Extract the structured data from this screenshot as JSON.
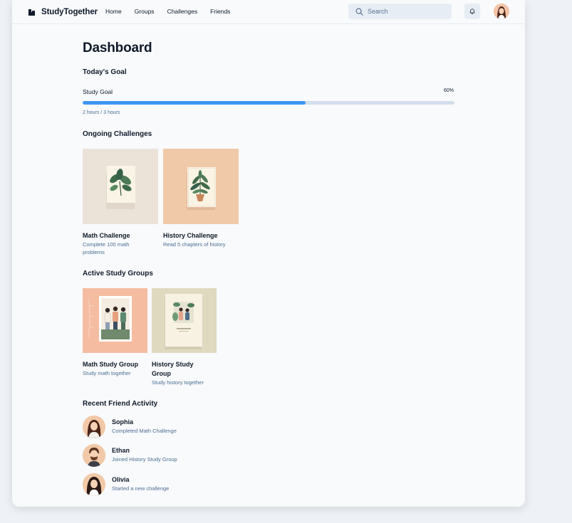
{
  "app": {
    "name": "StudyTogether",
    "nav": [
      "Home",
      "Groups",
      "Challenges",
      "Friends"
    ],
    "search_placeholder": "Search"
  },
  "page": {
    "title": "Dashboard"
  },
  "goal": {
    "section_title": "Today's Goal",
    "label": "Study Goal",
    "percent_label": "60%",
    "progress": 0.6,
    "detail": "2 hours / 3 hours"
  },
  "challenges": {
    "section_title": "Ongoing Challenges",
    "items": [
      {
        "title": "Math Challenge",
        "subtitle": "Complete 100 math problems",
        "tile_color": "#ebe3d7",
        "icon": "leaf-card-art"
      },
      {
        "title": "History Challenge",
        "subtitle": "Read 5 chapters of history",
        "tile_color": "#efc9a8",
        "icon": "potted-plant-card-art"
      }
    ]
  },
  "groups": {
    "section_title": "Active Study Groups",
    "items": [
      {
        "title": "Math Study Group",
        "subtitle": "Study math together",
        "tile_color": "#f5bca1",
        "icon": "friends-group-poster"
      },
      {
        "title": "History Study Group",
        "subtitle": "Study history together",
        "tile_color": "#dfd9c0",
        "icon": "friends-group-poster"
      }
    ]
  },
  "friends": {
    "section_title": "Recent Friend Activity",
    "items": [
      {
        "name": "Sophia",
        "activity": "Completed Math Challenge",
        "avatar_color": "#f2c9a8"
      },
      {
        "name": "Ethan",
        "activity": "Joined History Study Group",
        "avatar_color": "#f2c9a8"
      },
      {
        "name": "Olivia",
        "activity": "Started a new challenge",
        "avatar_color": "#f2c9a8"
      }
    ]
  },
  "colors": {
    "accent": "#3d97f0",
    "track": "#d3deea",
    "muted_text": "#4d6e92",
    "page_bg": "#f8fafc"
  }
}
